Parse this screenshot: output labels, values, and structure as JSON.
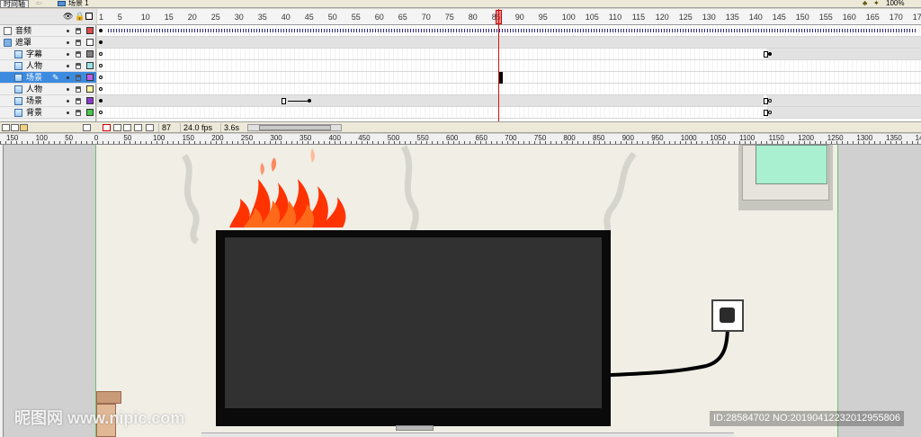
{
  "toolbar": {
    "timeline_button": "时间轴",
    "back_arrow": "⇦",
    "scene_label": "场景 1",
    "zoom_value": "100%",
    "zoom_icons": [
      "edit-scene-icon",
      "edit-symbol-icon"
    ]
  },
  "layers": {
    "header_icons": [
      "eye-icon",
      "lock-icon",
      "outline-icon"
    ],
    "items": [
      {
        "name": "音频",
        "type": "sound",
        "color": "#e04848",
        "indent": 0
      },
      {
        "name": "遮罩",
        "type": "folder",
        "color": "#ffffff",
        "indent": 0
      },
      {
        "name": "字幕",
        "type": "layer",
        "color": "#808080",
        "indent": 1
      },
      {
        "name": "人物",
        "type": "layer",
        "color": "#9ae3e3",
        "indent": 1
      },
      {
        "name": "场景",
        "type": "layer",
        "color": "#c25de8",
        "indent": 1,
        "selected": true
      },
      {
        "name": "人物",
        "type": "layer",
        "color": "#f7f79a",
        "indent": 1
      },
      {
        "name": "场景",
        "type": "layer",
        "color": "#8a3ad1",
        "indent": 1
      },
      {
        "name": "背景",
        "type": "layer",
        "color": "#45c845",
        "indent": 1
      }
    ]
  },
  "timeline": {
    "frame_numbers": [
      "1",
      "5",
      "10",
      "15",
      "20",
      "25",
      "30",
      "35",
      "40",
      "45",
      "50",
      "55",
      "60",
      "65",
      "70",
      "75",
      "80",
      "85",
      "90",
      "95",
      "100",
      "105",
      "110",
      "115",
      "120",
      "125",
      "130",
      "135",
      "140",
      "145",
      "150",
      "155",
      "160",
      "165",
      "170",
      "175"
    ],
    "current_frame": "87",
    "frame_rate": "24.0 fps",
    "elapsed_time": "3.6s",
    "playhead_color": "#d01010"
  },
  "stage_ruler": {
    "labels": [
      "150",
      "100",
      "50",
      "0",
      "50",
      "100",
      "150",
      "200",
      "250",
      "300",
      "350",
      "400",
      "450",
      "500",
      "550",
      "600",
      "650",
      "700",
      "750",
      "800",
      "850",
      "900",
      "950",
      "1000",
      "1050",
      "1100",
      "1150",
      "1200",
      "1250",
      "1300",
      "1350",
      "1400"
    ]
  },
  "stage": {
    "background": "#f0eee5",
    "tv_frame_color": "#0a0a0a",
    "tv_screen_color": "#313131",
    "window_glass_color": "#a8f0cf",
    "fire_colors": [
      "#ff3300",
      "#ff6a1a",
      "#ffb08a"
    ]
  },
  "watermark": {
    "logo": "昵图网 www.nipic.com",
    "id_text": "ID:28584702 NO:20190412232012955806"
  }
}
